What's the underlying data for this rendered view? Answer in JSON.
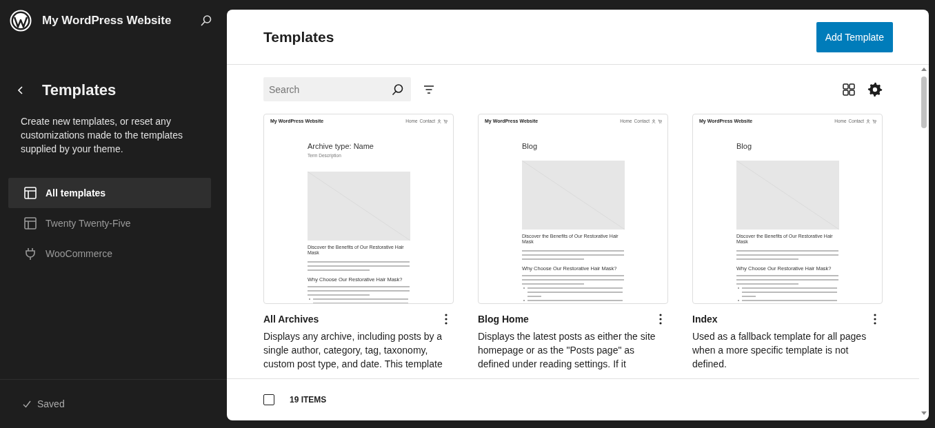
{
  "sidebar": {
    "site_title": "My WordPress Website",
    "section_title": "Templates",
    "description": "Create new templates, or reset any customizations made to the templates supplied by your theme.",
    "items": [
      {
        "label": "All templates",
        "kind": "layout",
        "selected": true
      },
      {
        "label": "Twenty Twenty-Five",
        "kind": "layout",
        "selected": false
      },
      {
        "label": "WooCommerce",
        "kind": "plug",
        "selected": false
      }
    ],
    "status": "Saved"
  },
  "main": {
    "title": "Templates",
    "add_button": "Add Template",
    "search": {
      "placeholder": "Search"
    },
    "templates": [
      {
        "name": "All Archives",
        "description": "Displays any archive, including posts by a single author, category, tag, taxonomy, custom post type, and date. This template",
        "preview": {
          "site_title": "My WordPress Website",
          "nav": [
            "Home",
            "Contact"
          ],
          "heading": "Archive type: Name",
          "subheading": "Term Description",
          "article_title": "Discover the Benefits of Our Restorative Hair Mask",
          "section_title": "Why Choose Our Restorative Hair Mask?"
        }
      },
      {
        "name": "Blog Home",
        "description": "Displays the latest posts as either the site homepage or as the \"Posts page\" as defined under reading settings. If it",
        "preview": {
          "site_title": "My WordPress Website",
          "nav": [
            "Home",
            "Contact"
          ],
          "heading": "Blog",
          "article_title": "Discover the Benefits of Our Restorative Hair Mask",
          "section_title": "Why Choose Our Restorative Hair Mask?"
        }
      },
      {
        "name": "Index",
        "description": "Used as a fallback template for all pages when a more specific template is not defined.",
        "preview": {
          "site_title": "My WordPress Website",
          "nav": [
            "Home",
            "Contact"
          ],
          "heading": "Blog",
          "article_title": "Discover the Benefits of Our Restorative Hair Mask",
          "section_title": "Why Choose Our Restorative Hair Mask?"
        }
      }
    ],
    "footer": {
      "select_all": {
        "checked": false
      },
      "count": "19 ITEMS"
    }
  }
}
